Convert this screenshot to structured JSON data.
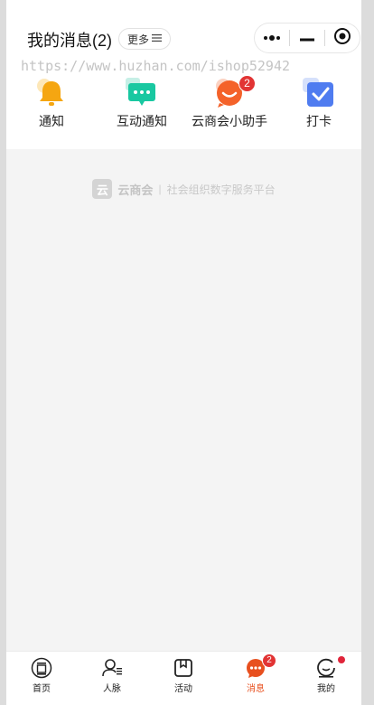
{
  "header": {
    "title": "我的消息(2)",
    "more_label": "更多",
    "more_icon": "menu-lines-icon",
    "capsule": {
      "more_icon": "dots-icon",
      "minimize_icon": "minus-icon",
      "close_icon": "target-circle-icon"
    }
  },
  "watermark": "https://www.huzhan.com/ishop52942",
  "categories": [
    {
      "label": "通知",
      "icon": "bell-icon",
      "color": "#f5a611"
    },
    {
      "label": "互动通知",
      "icon": "chat-bubble-icon",
      "color": "#19c8a1"
    },
    {
      "label": "云商会小助手",
      "icon": "smile-bubble-icon",
      "color": "#f4622a",
      "badge": "2"
    },
    {
      "label": "打卡",
      "icon": "check-icon",
      "color": "#4f7cf0"
    }
  ],
  "brand": {
    "logo_char": "云",
    "name": "云商会",
    "separator": "|",
    "slogan": "社会组织数字服务平台"
  },
  "tabbar": [
    {
      "label": "首页",
      "icon": "home-seal-icon"
    },
    {
      "label": "人脉",
      "icon": "contacts-icon"
    },
    {
      "label": "活动",
      "icon": "bookmark-icon"
    },
    {
      "label": "消息",
      "icon": "message-icon",
      "badge": "2",
      "active": true
    },
    {
      "label": "我的",
      "icon": "profile-icon",
      "dot": true
    }
  ],
  "colors": {
    "accent": "#e8501f",
    "badge": "#e23434",
    "background": "#f4f4f4"
  }
}
